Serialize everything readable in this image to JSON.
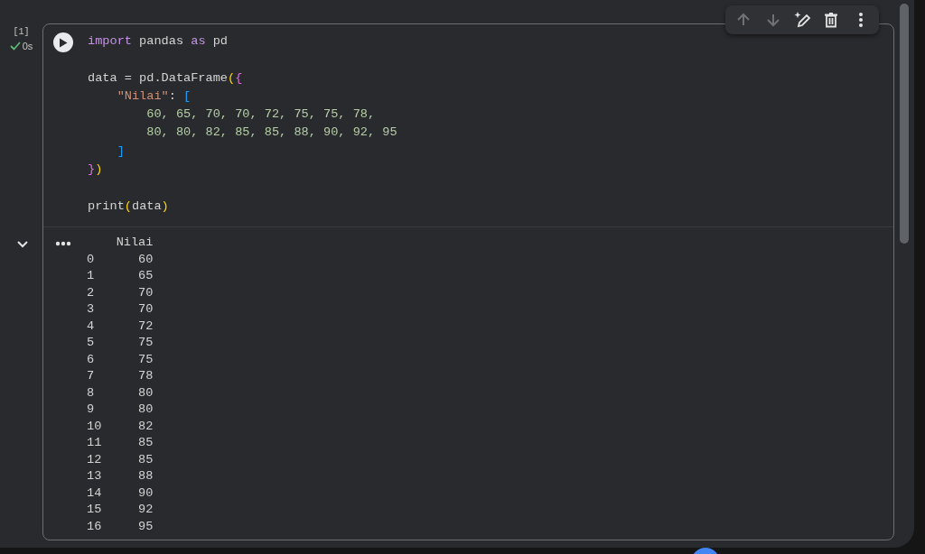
{
  "cell": {
    "execution_count": "[1]",
    "succeeded": true,
    "duration": "0s",
    "toolbar": [
      {
        "kind": "up",
        "disabled": true
      },
      {
        "kind": "down",
        "disabled": true
      },
      {
        "kind": "edit",
        "disabled": false
      },
      {
        "kind": "delete",
        "disabled": false
      },
      {
        "kind": "more",
        "disabled": false
      }
    ],
    "code": [
      {
        "tokens": [
          {
            "kind": "keyword",
            "text": "import"
          },
          {
            "kind": "plain",
            "text": " pandas "
          },
          {
            "kind": "keyword",
            "text": "as"
          },
          {
            "kind": "plain",
            "text": " pd"
          }
        ]
      },
      {
        "blank_before": true,
        "tokens": [
          {
            "kind": "plain",
            "text": "data = pd.DataFrame"
          },
          {
            "kind": "bracket1",
            "text": "("
          },
          {
            "kind": "bracket2",
            "text": "{"
          }
        ]
      },
      {
        "tokens": [
          {
            "kind": "string",
            "text": "    \"Nilai\""
          },
          {
            "kind": "plain",
            "text": ": "
          },
          {
            "kind": "bracket3",
            "text": "["
          }
        ]
      },
      {
        "tokens": [
          {
            "kind": "number",
            "text": "        60, 65, 70, 70, 72, 75, 75, 78,"
          }
        ]
      },
      {
        "tokens": [
          {
            "kind": "number",
            "text": "        80, 80, 82, 85, 85, 88, 90, 92, 95"
          }
        ]
      },
      {
        "tokens": [
          {
            "kind": "bracket3",
            "text": "    ]"
          }
        ]
      },
      {
        "tokens": [
          {
            "kind": "bracket2",
            "text": "}"
          },
          {
            "kind": "bracket1",
            "text": ")"
          }
        ]
      },
      {
        "blank_before": true,
        "tokens": [
          {
            "kind": "plain",
            "text": "print"
          },
          {
            "kind": "bracket1",
            "text": "("
          },
          {
            "kind": "plain",
            "text": "data"
          },
          {
            "kind": "bracket1",
            "text": ")"
          }
        ]
      }
    ],
    "output": {
      "expanded": true,
      "lines": [
        "    Nilai",
        "0      60",
        "1      65",
        "2      70",
        "3      70",
        "4      72",
        "5      75",
        "6      75",
        "7      78",
        "8      80",
        "9      80",
        "10     82",
        "11     85",
        "12     85",
        "13     88",
        "14     90",
        "15     92",
        "16     95"
      ]
    }
  }
}
